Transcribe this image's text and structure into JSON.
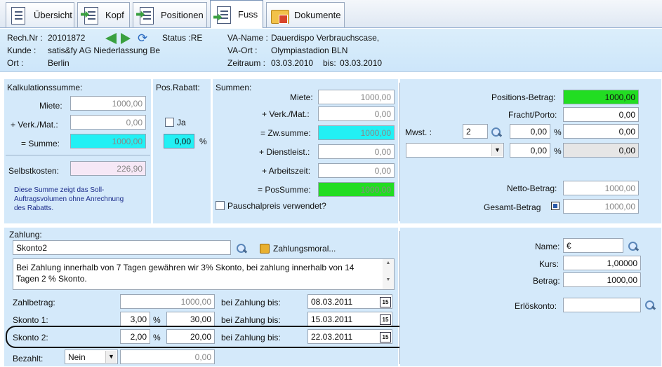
{
  "tabs": [
    {
      "label": "Übersicht"
    },
    {
      "label": "Kopf"
    },
    {
      "label": "Positionen"
    },
    {
      "label": "Fuss"
    },
    {
      "label": "Dokumente"
    }
  ],
  "header": {
    "rechnr_label": "Rech.Nr :",
    "rechnr": "20101872",
    "status_label": "Status :RE",
    "kunde_label": "Kunde :",
    "kunde": "satis&fy AG Niederlassung Be",
    "ort_label": "Ort :",
    "ort": "Berlin",
    "va_name_label": "VA-Name :",
    "va_name": "Dauerdispo Verbrauchscase,",
    "va_ort_label": "VA-Ort :",
    "va_ort": "Olympiastadion BLN",
    "zeitraum_label": "Zeitraum :",
    "zeitraum": "03.03.2010",
    "bis_label": "bis:",
    "bis": "03.03.2010"
  },
  "kalk": {
    "title": "Kalkulationssumme:",
    "miete_label": "Miete:",
    "miete": "1000,00",
    "verk_label": "+ Verk./Mat.:",
    "verk": "0,00",
    "summe_label": "= Summe:",
    "summe": "1000,00",
    "selbst_label": "Selbstkosten:",
    "selbst": "226,90",
    "note": "Diese Summe zeigt das Soll-Auftragsvolumen ohne Anrechnung des Rabatts."
  },
  "rabatt": {
    "title": "Pos.Rabatt:",
    "ja_label": "Ja",
    "value": "0,00",
    "pct": "%"
  },
  "summen": {
    "title": "Summen:",
    "miete_label": "Miete:",
    "miete": "1000,00",
    "verk_label": "+ Verk./Mat.:",
    "verk": "0,00",
    "zw_label": "= Zw.summe:",
    "zw": "1000,00",
    "dienst_label": "+ Dienstleist.:",
    "dienst": "0,00",
    "arbeit_label": "+ Arbeitszeit:",
    "arbeit": "0,00",
    "pos_label": "= PosSumme:",
    "pos": "1000,00",
    "pauschal_label": "Pauschalpreis verwendet?"
  },
  "right": {
    "posbetrag_label": "Positions-Betrag:",
    "posbetrag": "1000,00",
    "fracht_label": "Fracht/Porto:",
    "fracht": "0,00",
    "mwst_label": "Mwst. :",
    "mwst_code": "2",
    "mwst_pct": "0,00",
    "mwst_val": "0,00",
    "pct": "%",
    "row2_pct": "0,00",
    "row2_val": "0,00",
    "netto_label": "Netto-Betrag:",
    "netto": "1000,00",
    "gesamt_label": "Gesamt-Betrag",
    "gesamt": "1000,00"
  },
  "zahlung": {
    "title": "Zahlung:",
    "skonto_select": "Skonto2",
    "moral_label": "Zahlungsmoral...",
    "text": "Bei Zahlung innerhalb von 7 Tagen gewähren wir 3% Skonto, bei zahlung innerhalb von 14 Tagen 2 % Skonto.",
    "zahlbetrag_label": "Zahlbetrag:",
    "zahlbetrag": "1000,00",
    "bei_label": "bei Zahlung bis:",
    "bis1": "08.03.2011",
    "skonto1_label": "Skonto 1:",
    "skonto1_pct": "3,00",
    "skonto1_val": "30,00",
    "bis2": "15.03.2011",
    "skonto2_label": "Skonto 2:",
    "skonto2_pct": "2,00",
    "skonto2_val": "20,00",
    "bis3": "22.03.2011",
    "bezahlt_label": "Bezahlt:",
    "bezahlt_sel": "Nein",
    "bezahlt_val": "0,00",
    "pct": "%",
    "cal": "15"
  },
  "currency": {
    "name_label": "Name:",
    "name": "€",
    "kurs_label": "Kurs:",
    "kurs": "1,00000",
    "betrag_label": "Betrag:",
    "betrag": "1000,00",
    "erlos_label": "Erlöskonto:"
  }
}
